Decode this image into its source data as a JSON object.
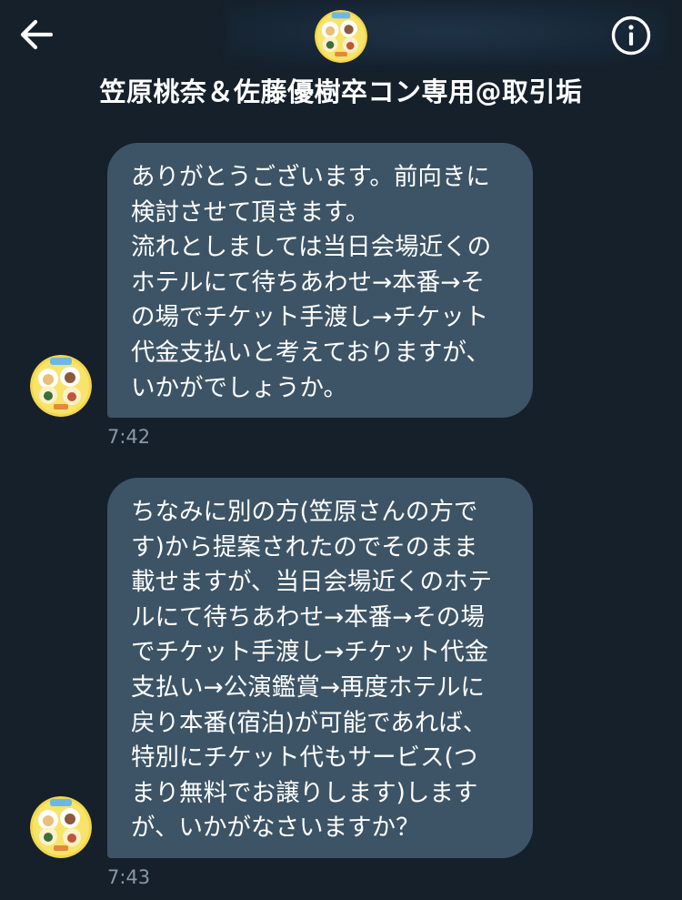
{
  "header": {
    "title": "笠原桃奈＆佐藤優樹卒コン専用@取引垢",
    "back_icon": "arrow-left-icon",
    "info_icon": "info-circle-icon"
  },
  "colors": {
    "background": "#15202b",
    "bubble": "#3d5466",
    "timestamp": "#8899a6",
    "text": "#ffffff"
  },
  "messages": [
    {
      "lines": [
        "ありがとうございます。前向きに",
        "検討させて頂きます。",
        "流れとしましては当日会場近くの",
        "ホテルにて待ちあわせ→本番→そ",
        "の場でチケット手渡し→チケット",
        "代金支払いと考えておりますが、",
        "いかがでしょうか。"
      ],
      "time": "7:42"
    },
    {
      "lines": [
        "ちなみに別の方(笠原さんの方で",
        "す)から提案されたのでそのまま",
        "載せますが、当日会場近くのホテ",
        "ルにて待ちあわせ→本番→その場",
        "でチケット手渡し→チケット代金",
        "支払い→公演鑑賞→再度ホテルに",
        "戻り本番(宿泊)が可能であれば、",
        "特別にチケット代もサービス(つ",
        "まり無料でお譲りします)します",
        "が、いかがなさいますか？"
      ],
      "time": "7:43"
    }
  ]
}
